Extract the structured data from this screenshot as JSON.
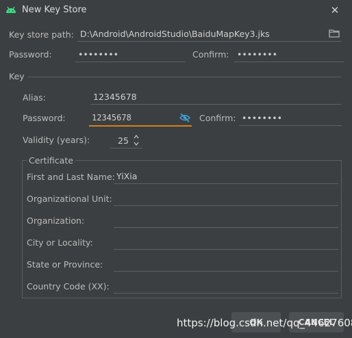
{
  "window": {
    "title": "New Key Store"
  },
  "keystore": {
    "path_label": "Key store path:",
    "path_value": "D:\\Android\\AndroidStudio\\BaiduMapKey3.jks",
    "password_label": "Password:",
    "password_value": "••••••••",
    "confirm_label": "Confirm:",
    "confirm_value": "••••••••"
  },
  "key": {
    "section_label": "Key",
    "alias_label": "Alias:",
    "alias_value": "12345678",
    "password_label": "Password:",
    "password_value": "12345678",
    "confirm_label": "Confirm:",
    "confirm_value": "••••••••",
    "validity_label": "Validity (years):",
    "validity_value": "25"
  },
  "certificate": {
    "section_label": "Certificate",
    "fields": [
      {
        "label": "First and Last Name:",
        "value": "YiXia"
      },
      {
        "label": "Organizational Unit:",
        "value": ""
      },
      {
        "label": "Organization:",
        "value": ""
      },
      {
        "label": "City or Locality:",
        "value": ""
      },
      {
        "label": "State or Province:",
        "value": ""
      },
      {
        "label": "Country Code (XX):",
        "value": ""
      }
    ]
  },
  "buttons": {
    "ok_label": "OK",
    "cancel_label": "CANCEL"
  },
  "watermark": "https://blog.csdn.net/qq_44627608",
  "colors": {
    "background": "#3c3f41",
    "accent_focus": "#d77f1c",
    "android_icon": "#3ddc84"
  },
  "icons": {
    "app": "android-icon",
    "close": "close-icon",
    "folder": "folder-icon",
    "visibility": "eye-slash-icon",
    "spinner": "spinner-arrows-icon"
  }
}
